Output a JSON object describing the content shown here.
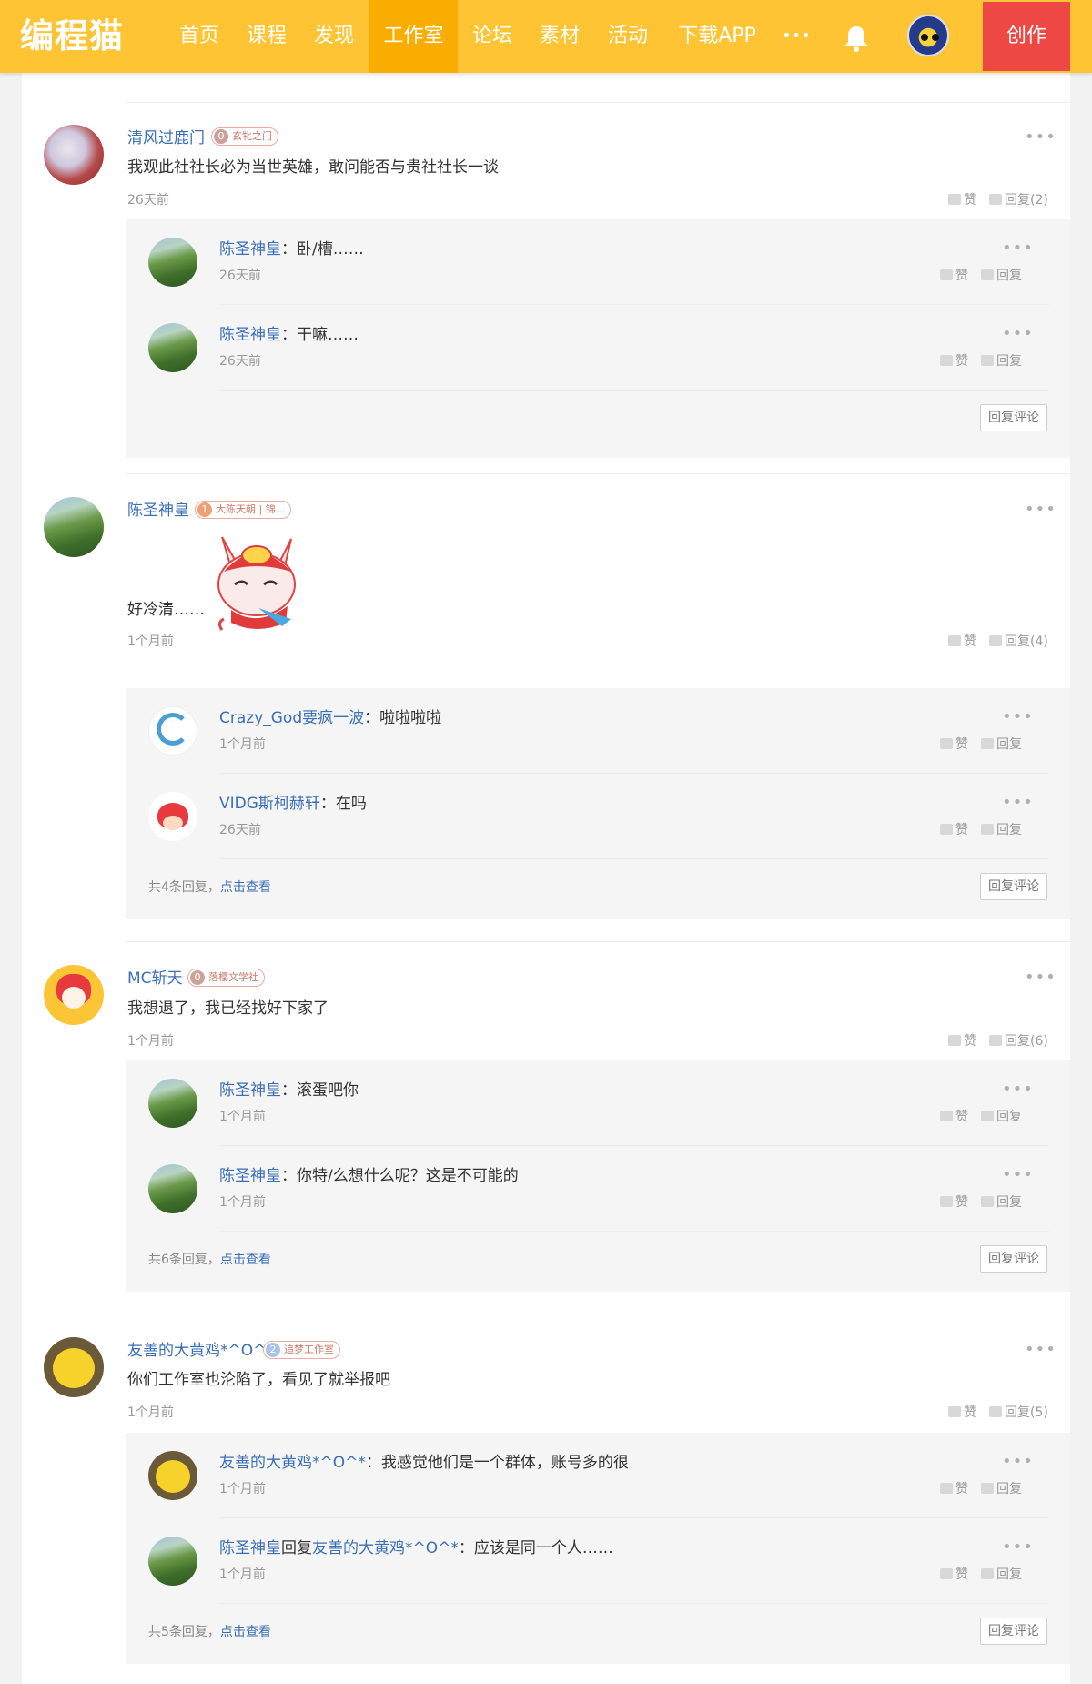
{
  "nav": {
    "logo": "编程猫",
    "items": [
      {
        "label": "首页",
        "active": false
      },
      {
        "label": "课程",
        "active": false
      },
      {
        "label": "发现",
        "active": false
      },
      {
        "label": "工作室",
        "active": true
      },
      {
        "label": "论坛",
        "active": false
      },
      {
        "label": "素材",
        "active": false
      },
      {
        "label": "活动",
        "active": false
      },
      {
        "label": "下载APP",
        "active": false
      },
      {
        "label": "•••",
        "active": false
      }
    ],
    "create_label": "创作",
    "colors": {
      "bar": "#fec433",
      "active": "#f8ad00",
      "create": "#ee4845"
    }
  },
  "common": {
    "like": "赞",
    "reply": "回复",
    "more": "•••",
    "reply_comment": "回复评论",
    "view_link": "点击查看"
  },
  "comments": [
    {
      "user": "清风过鹿门",
      "level": "0",
      "badge": "玄牝之门",
      "text": "我观此社社长必为当世英雄，敢问能否与贵社社长一谈",
      "time": "26天前",
      "reply_count": "回复(2)",
      "replies": [
        {
          "user": "陈圣神皇",
          "sep": "：",
          "text": "卧/槽……",
          "time": "26天前"
        },
        {
          "user": "陈圣神皇",
          "sep": "：",
          "text": "干嘛……",
          "time": "26天前"
        }
      ],
      "footer": ""
    },
    {
      "user": "陈圣神皇",
      "level": "1",
      "badge": "大陈天朝 | 锦...",
      "text": "好冷清……",
      "time": "1个月前",
      "reply_count": "回复(4)",
      "replies": [
        {
          "user": "Crazy_God要疯一波",
          "sep": "：",
          "text": "啦啦啦啦",
          "time": "1个月前"
        },
        {
          "user": "VIDG斯柯赫轩",
          "sep": "：",
          "text": "在吗",
          "time": "26天前"
        }
      ],
      "footer": "共4条回复，"
    },
    {
      "user": "MC斩天",
      "level": "0",
      "badge": "落樱文学社",
      "text": "我想退了，我已经找好下家了",
      "time": "1个月前",
      "reply_count": "回复(6)",
      "replies": [
        {
          "user": "陈圣神皇",
          "sep": "：",
          "text": "滚蛋吧你",
          "time": "1个月前"
        },
        {
          "user": "陈圣神皇",
          "sep": "：",
          "text": "你特/么想什么呢？这是不可能的",
          "time": "1个月前"
        }
      ],
      "footer": "共6条回复，"
    },
    {
      "user": "友善的大黄鸡*^O^*",
      "level": "2",
      "badge": "追梦工作室",
      "text": "你们工作室也沦陷了，看见了就举报吧",
      "time": "1个月前",
      "reply_count": "回复(5)",
      "replies": [
        {
          "user": "友善的大黄鸡*^O^*",
          "sep": "：",
          "text": "我感觉他们是一个群体，账号多的很",
          "time": "1个月前"
        },
        {
          "user": "陈圣神皇",
          "mid": "回复",
          "target": "友善的大黄鸡*^O^*",
          "sep": "：",
          "text": "应该是同一个人……",
          "time": "1个月前"
        }
      ],
      "footer": "共5条回复，"
    }
  ]
}
